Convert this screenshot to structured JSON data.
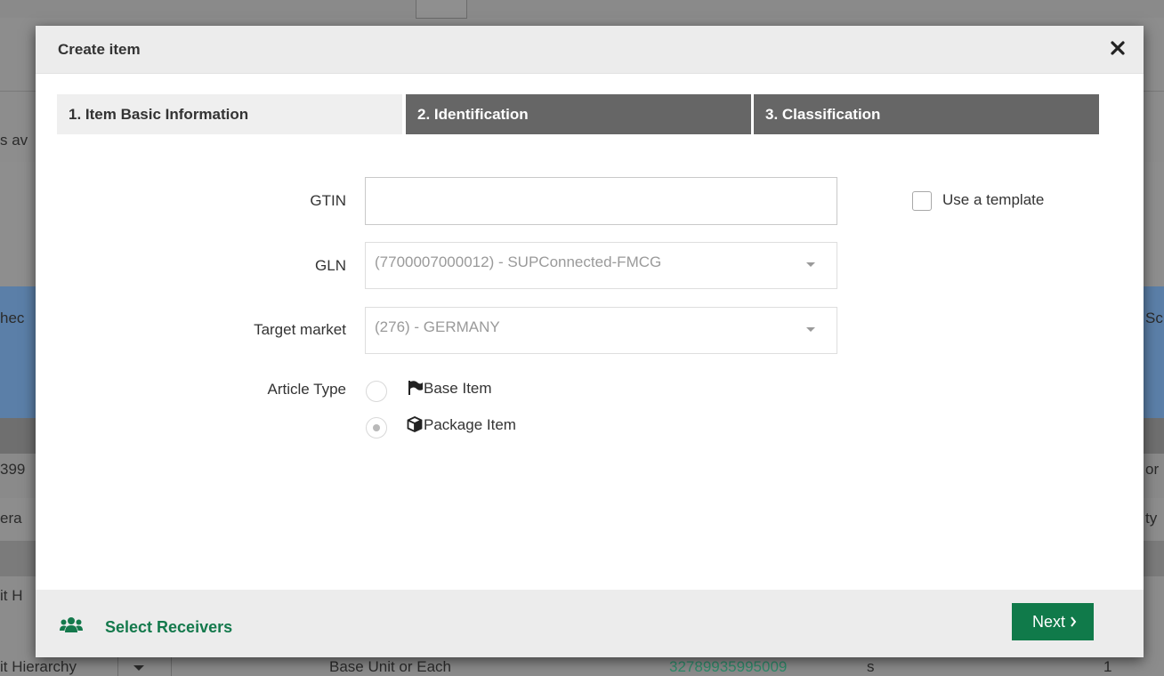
{
  "background": {
    "frag_left_1": "s av",
    "frag_left_2": "hec",
    "frag_right_2": "Sc",
    "frag_left_3": "399",
    "frag_right_3": "or",
    "frag_left_4": "era",
    "frag_right_4": "ty",
    "frag_left_5": "it H",
    "bottom_row": {
      "hierarchy": "it Hierarchy",
      "unit": "Base Unit or Each",
      "gtin": "32789935995009",
      "unit_code": "s",
      "qty": "1"
    },
    "accent_green": "#2e8b6a",
    "band_blue": "#5b7fa8"
  },
  "modal": {
    "title": "Create item",
    "close_icon": "close-icon",
    "steps": [
      {
        "label": "1. Item Basic Information",
        "state": "active"
      },
      {
        "label": "2. Identification",
        "state": "inactive"
      },
      {
        "label": "3. Classification",
        "state": "inactive"
      }
    ],
    "form": {
      "gtin_label": "GTIN",
      "gtin_value": "",
      "template_label": "Use a template",
      "template_checked": false,
      "gln_label": "GLN",
      "gln_value": "(7700007000012) - SUPConnected-FMCG",
      "market_label": "Target market",
      "market_value": "(276) - GERMANY",
      "article_type_label": "Article Type",
      "article_options": [
        {
          "label": "Base Item",
          "icon": "flag-icon",
          "selected": false
        },
        {
          "label": "Package Item",
          "icon": "cube-icon",
          "selected": true
        }
      ]
    },
    "footer": {
      "receivers_label": "Select Receivers",
      "receivers_icon": "users-icon",
      "next_label": "Next",
      "next_icon": "chevron-right-icon"
    },
    "colors": {
      "primary_green": "#107a4a",
      "step_inactive": "#666666",
      "step_active": "#efefef"
    }
  }
}
